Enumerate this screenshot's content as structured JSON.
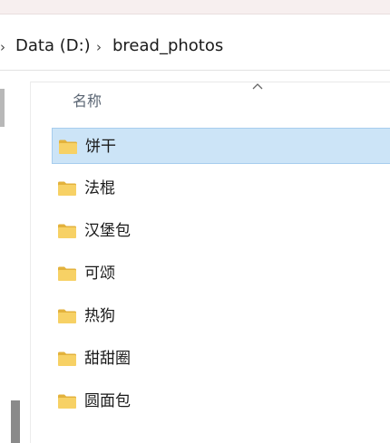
{
  "address": {
    "crumbs": [
      "Data (D:)",
      "bread_photos"
    ],
    "separator": "›"
  },
  "list": {
    "column_name": "名称",
    "items": [
      {
        "label": "饼干",
        "selected": true
      },
      {
        "label": "法棍",
        "selected": false
      },
      {
        "label": "汉堡包",
        "selected": false
      },
      {
        "label": "可颂",
        "selected": false
      },
      {
        "label": "热狗",
        "selected": false
      },
      {
        "label": "甜甜圈",
        "selected": false
      },
      {
        "label": "圆面包",
        "selected": false
      }
    ]
  },
  "colors": {
    "selection_fill": "#cce4f7",
    "selection_border": "#a7cdee",
    "folder_yellow": "#f7d165",
    "folder_dark": "#e3b23c"
  },
  "icons": {
    "folder": "folder-icon",
    "sort": "sort-ascending-caret-icon",
    "breadcrumb_separator": "chevron-right-icon"
  }
}
